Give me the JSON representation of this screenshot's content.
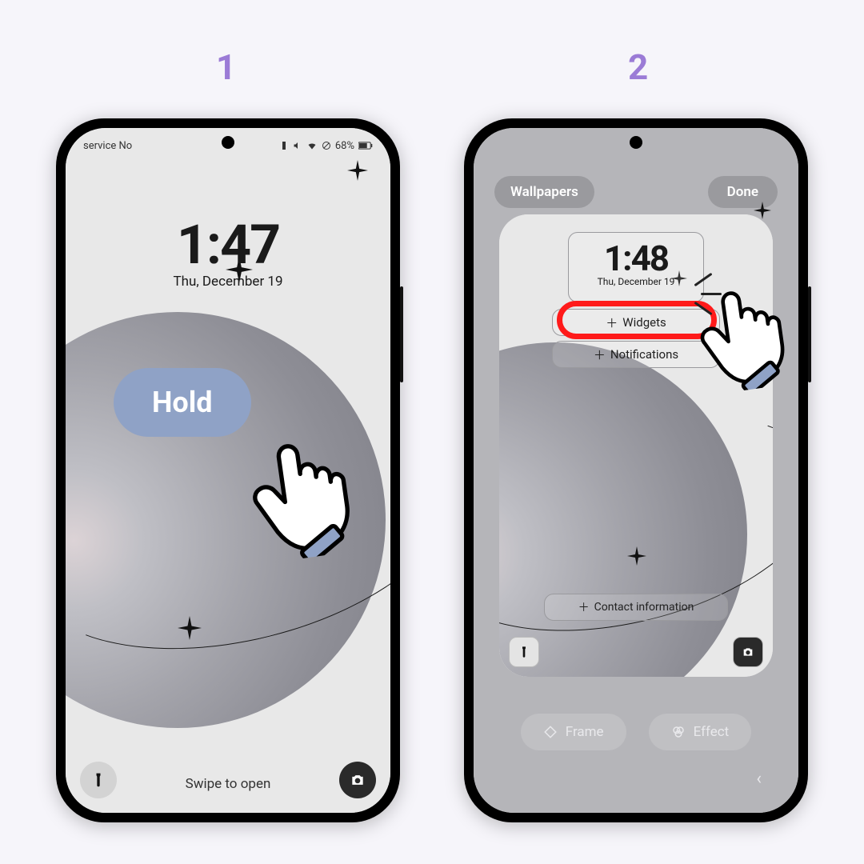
{
  "steps": {
    "one": "1",
    "two": "2"
  },
  "screen1": {
    "status_left": "service    No",
    "battery_text": "68%",
    "time": "1:47",
    "date": "Thu, December 19",
    "swipe": "Swipe to open",
    "hold_label": "Hold"
  },
  "screen2": {
    "wallpapers_label": "Wallpapers",
    "done_label": "Done",
    "time": "1:48",
    "date": "Thu, December 19",
    "widgets_label": "Widgets",
    "notifications_label": "Notifications",
    "contact_label": "Contact information",
    "frame_label": "Frame",
    "effect_label": "Effect"
  }
}
